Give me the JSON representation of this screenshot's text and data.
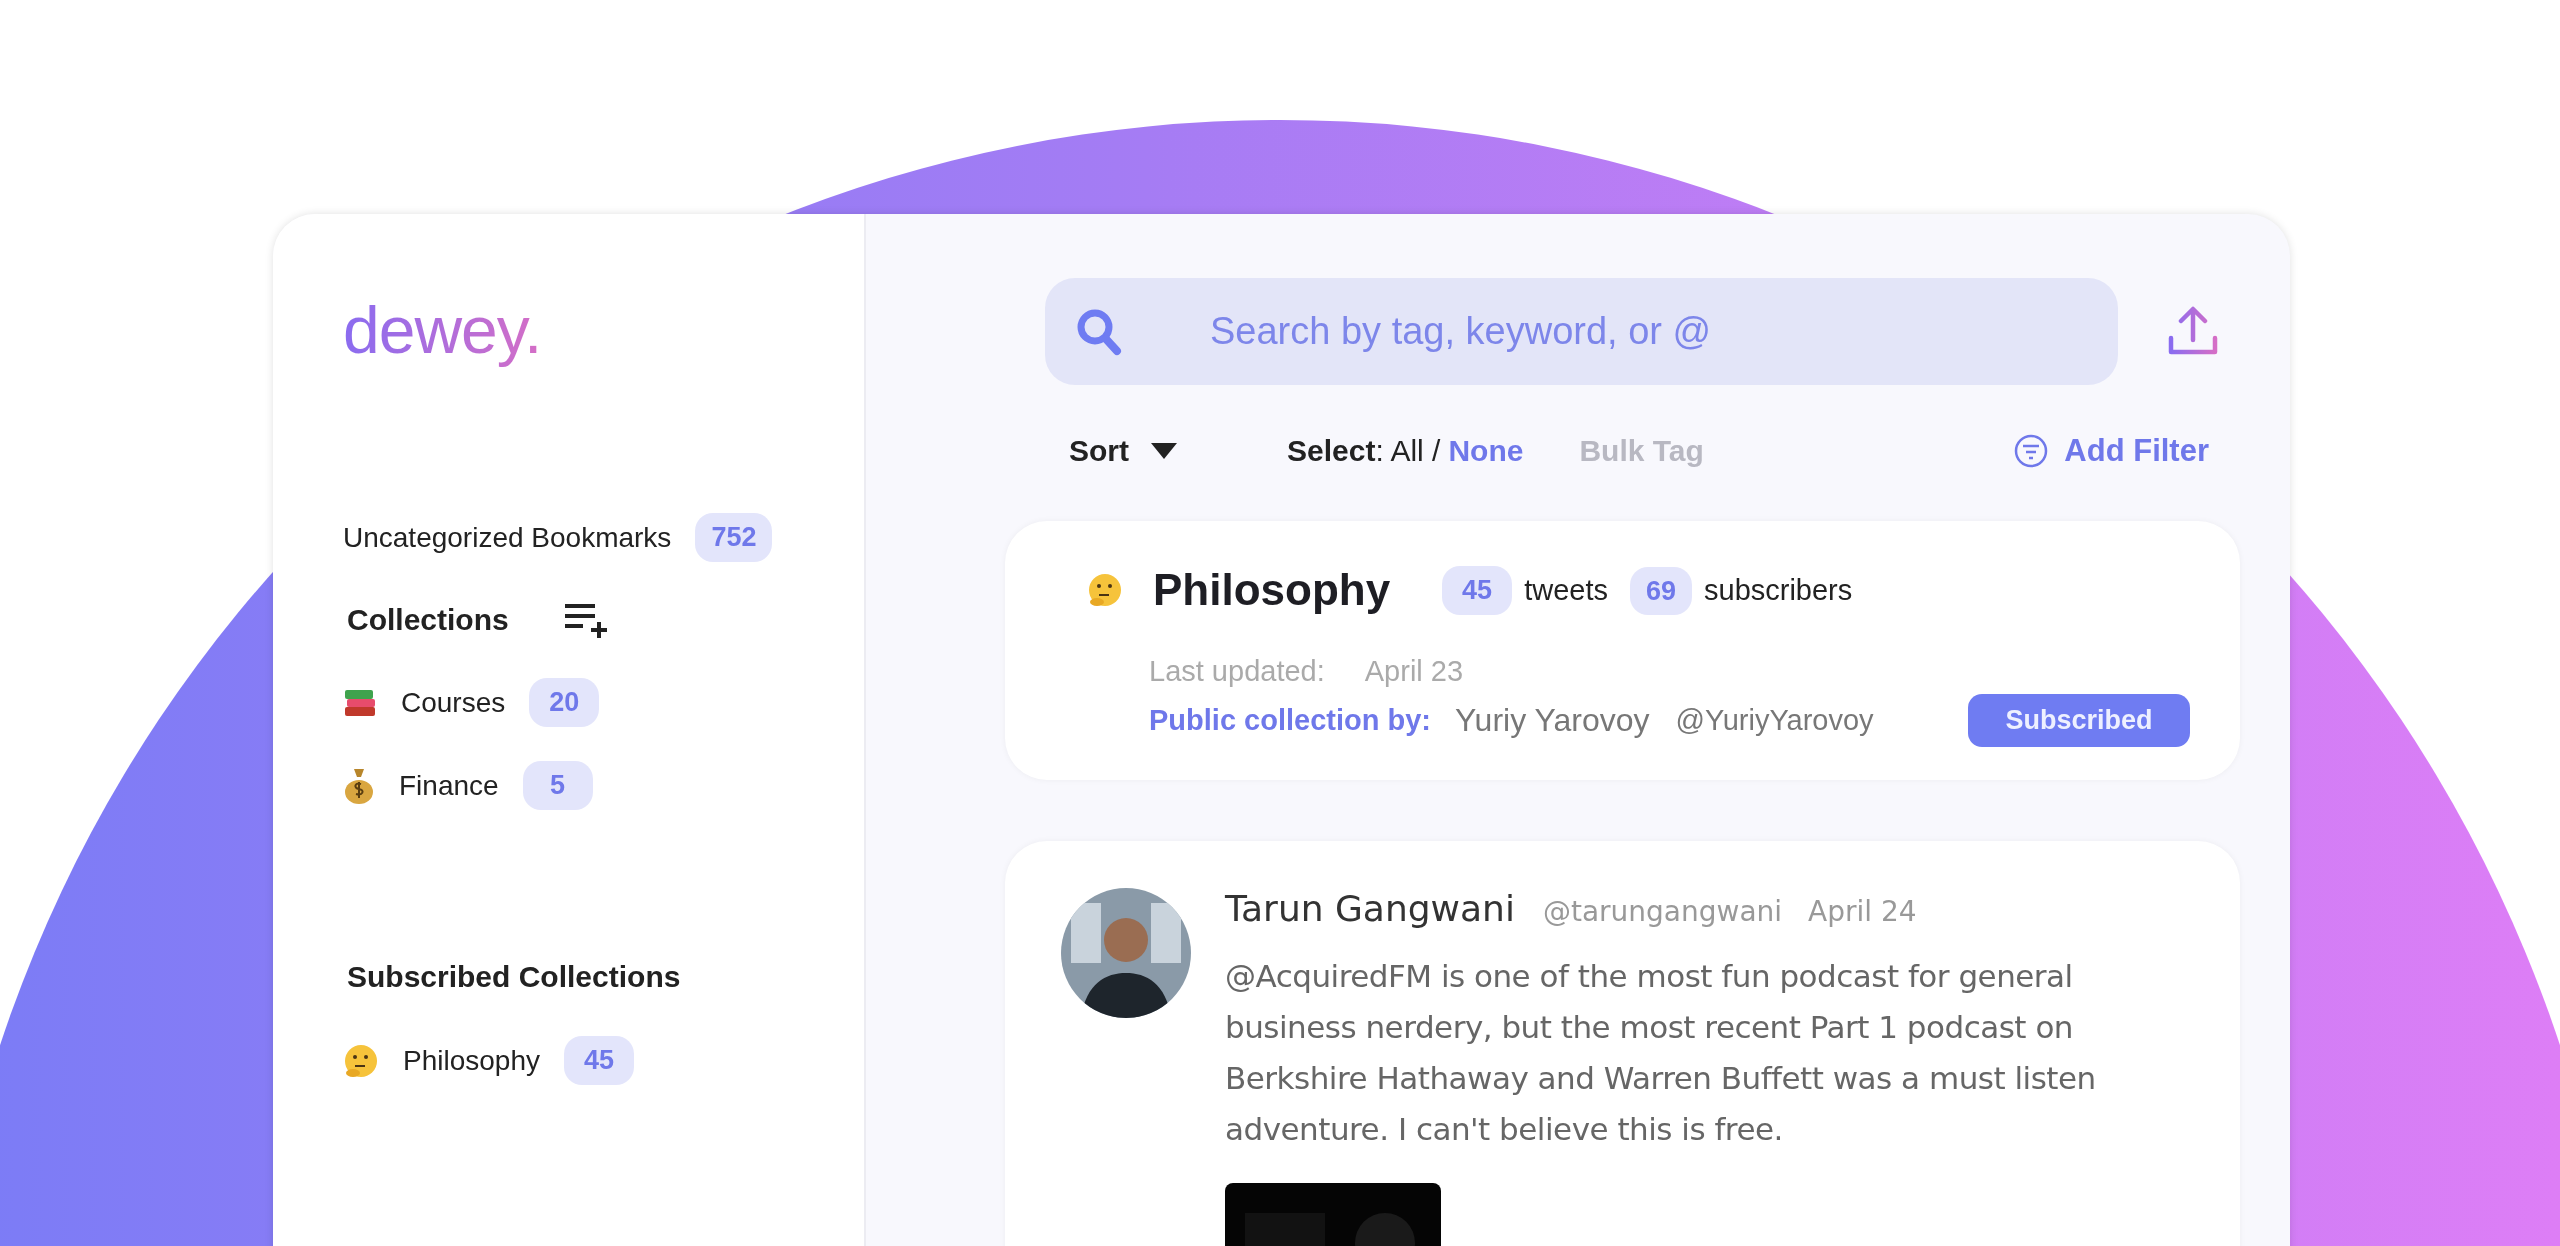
{
  "logo": "dewey.",
  "sidebar": {
    "uncategorized": {
      "label": "Uncategorized Bookmarks",
      "count": "752"
    },
    "collections_heading": "Collections",
    "collections": [
      {
        "kind": "books",
        "name": "Courses",
        "count": "20"
      },
      {
        "kind": "money-bag",
        "name": "Finance",
        "count": "5"
      }
    ],
    "subscribed_heading": "Subscribed Collections",
    "subscribed": [
      {
        "kind": "thinking",
        "name": "Philosophy",
        "count": "45"
      }
    ]
  },
  "search": {
    "placeholder": "Search by tag, keyword, or @"
  },
  "toolbar": {
    "sort": "Sort",
    "select_prefix": "**Select**: All /",
    "select_none": "None",
    "bulk_tag": {
      "label": "Bulk Tag",
      "disabled": true
    },
    "add_filter": "Add Filter"
  },
  "collection_card": {
    "kind": "thinking",
    "title": "Philosophy",
    "tweets_count": "45",
    "tweets_label": "tweets",
    "subscribers_count": "69",
    "subscribers_label": "subscribers",
    "last_updated_label": "Last updated:",
    "last_updated": "April 23",
    "author_label": "Public collection by:",
    "author_name": "Yuriy Yarovoy",
    "author_handle": "@YuriyYarovoy",
    "button": "Subscribed"
  },
  "tweet": {
    "author": "Tarun Gangwani",
    "handle": "@tarungangwani",
    "date": "April 24",
    "text": "@AcquiredFM is one of the most fun podcast for general business nerdery, but the most recent Part 1 podcast on Berkshire Hathaway and Warren Buffett was a must listen adventure. I can't believe this is free."
  }
}
